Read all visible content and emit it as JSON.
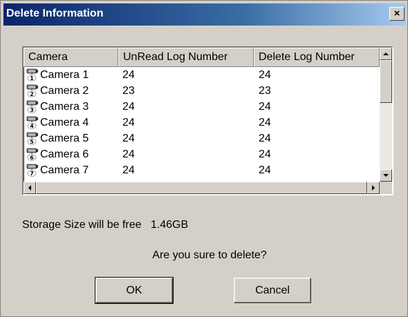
{
  "window": {
    "title": "Delete Information",
    "close_label": "×"
  },
  "table": {
    "columns": [
      "Camera",
      "UnRead Log Number",
      "Delete Log Number"
    ],
    "rows": [
      {
        "camera": "Camera 1",
        "icon_number": "1",
        "unread": "24",
        "delete": "24"
      },
      {
        "camera": "Camera 2",
        "icon_number": "2",
        "unread": "23",
        "delete": "23"
      },
      {
        "camera": "Camera 3",
        "icon_number": "3",
        "unread": "24",
        "delete": "24"
      },
      {
        "camera": "Camera 4",
        "icon_number": "4",
        "unread": "24",
        "delete": "24"
      },
      {
        "camera": "Camera 5",
        "icon_number": "5",
        "unread": "24",
        "delete": "24"
      },
      {
        "camera": "Camera 6",
        "icon_number": "6",
        "unread": "24",
        "delete": "24"
      },
      {
        "camera": "Camera 7",
        "icon_number": "7",
        "unread": "24",
        "delete": "24"
      }
    ],
    "icon": "camera-icon"
  },
  "storage": {
    "label": "Storage Size will be free",
    "value": "1.46GB"
  },
  "confirm_text": "Are you sure to delete?",
  "buttons": {
    "ok": "OK",
    "cancel": "Cancel"
  },
  "colors": {
    "title_start": "#0a246a",
    "title_end": "#a6caf0",
    "face": "#d4d0c8"
  }
}
